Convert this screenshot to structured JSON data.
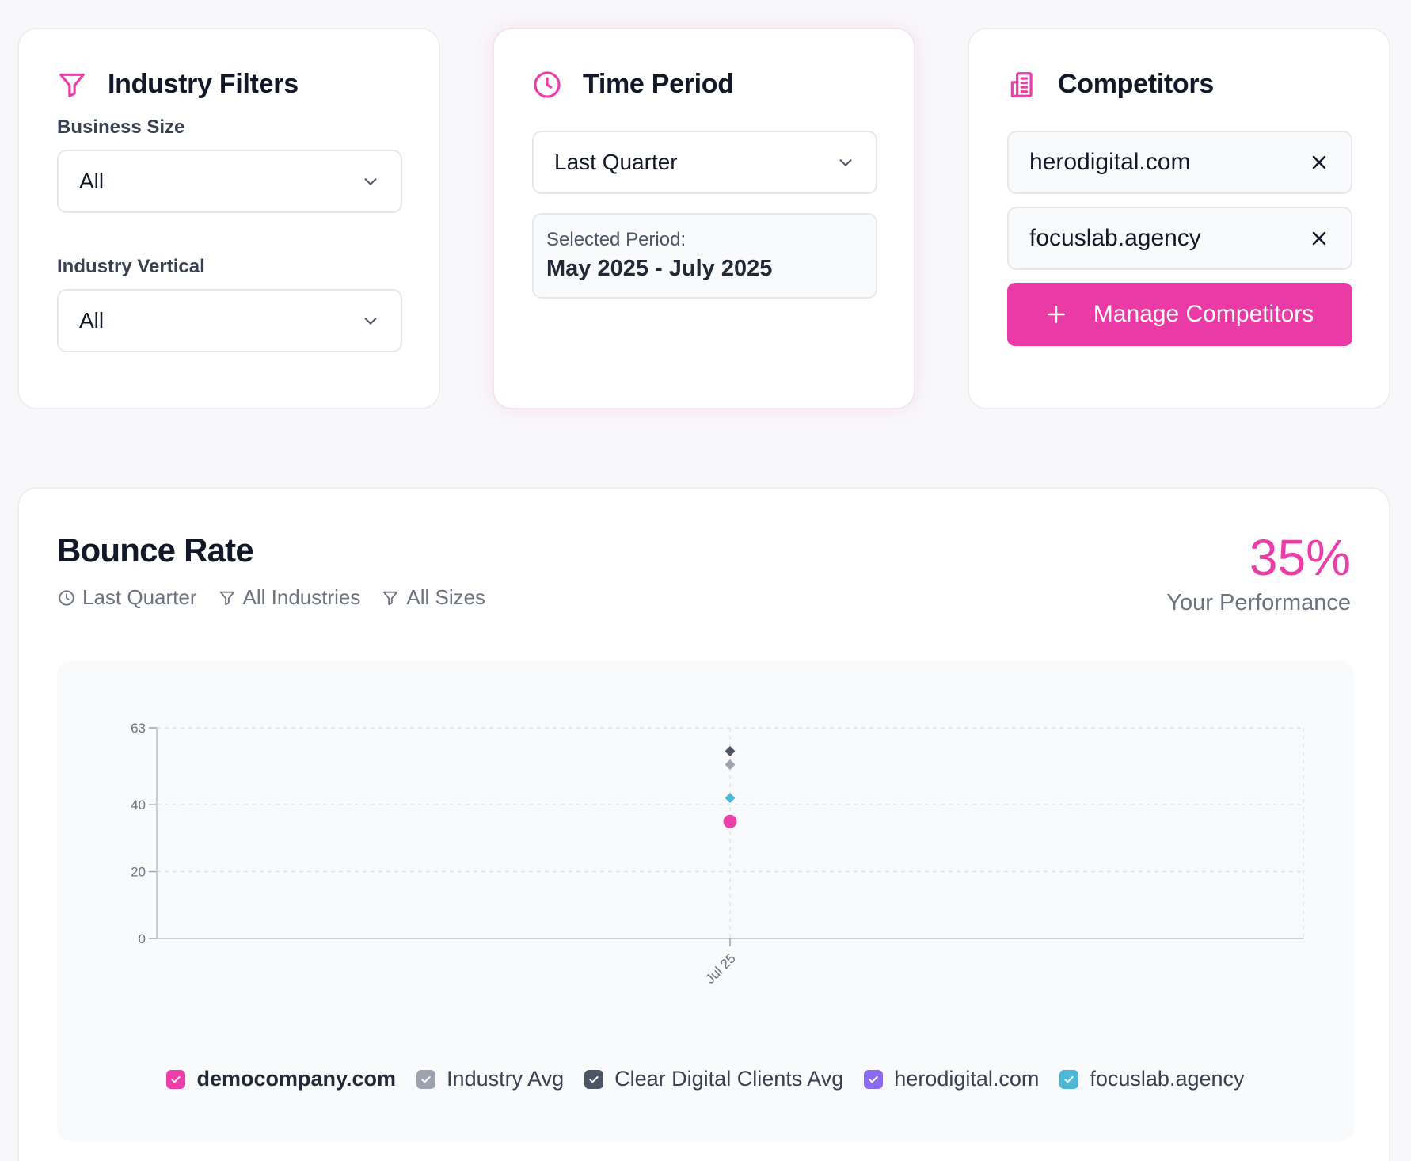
{
  "filters": {
    "title": "Industry Filters",
    "icon": "filter-icon",
    "business_size": {
      "label": "Business Size",
      "value": "All"
    },
    "industry_vertical": {
      "label": "Industry Vertical",
      "value": "All"
    }
  },
  "time_period": {
    "title": "Time Period",
    "icon": "clock-icon",
    "select_value": "Last Quarter",
    "selected_label": "Selected Period:",
    "selected_value": "May 2025 - July 2025"
  },
  "competitors": {
    "title": "Competitors",
    "icon": "building-icon",
    "items": [
      {
        "name": "herodigital.com"
      },
      {
        "name": "focuslab.agency"
      }
    ],
    "manage_label": "Manage Competitors"
  },
  "bounce": {
    "title": "Bounce Rate",
    "meta": [
      "Last Quarter",
      "All Industries",
      "All Sizes"
    ],
    "performance_value": "35%",
    "performance_label": "Your Performance"
  },
  "colors": {
    "accent": "#ea3aa5",
    "democompany": "#ec3ea8",
    "industry_avg": "#9ca3af",
    "clear_digital": "#4b5563",
    "herodigital": "#8b6cf0",
    "focuslab": "#4fb7d6"
  },
  "chart_data": {
    "type": "scatter",
    "x": [
      "Jul 25"
    ],
    "ylim": [
      0,
      63
    ],
    "yticks": [
      0,
      20,
      40,
      63
    ],
    "grid": true,
    "legend_position": "bottom",
    "series": [
      {
        "name": "democompany.com",
        "values": [
          35
        ],
        "marker": "circle",
        "color": "#ec3ea8",
        "checked": true,
        "bold": true
      },
      {
        "name": "Industry Avg",
        "values": [
          52
        ],
        "marker": "diamond",
        "color": "#9ca3af",
        "checked": true
      },
      {
        "name": "Clear Digital Clients Avg",
        "values": [
          56
        ],
        "marker": "diamond",
        "color": "#4b5563",
        "checked": true
      },
      {
        "name": "herodigital.com",
        "values": [
          null
        ],
        "marker": "diamond",
        "color": "#8b6cf0",
        "checked": true
      },
      {
        "name": "focuslab.agency",
        "values": [
          42
        ],
        "marker": "diamond",
        "color": "#4fb7d6",
        "checked": true
      }
    ]
  }
}
